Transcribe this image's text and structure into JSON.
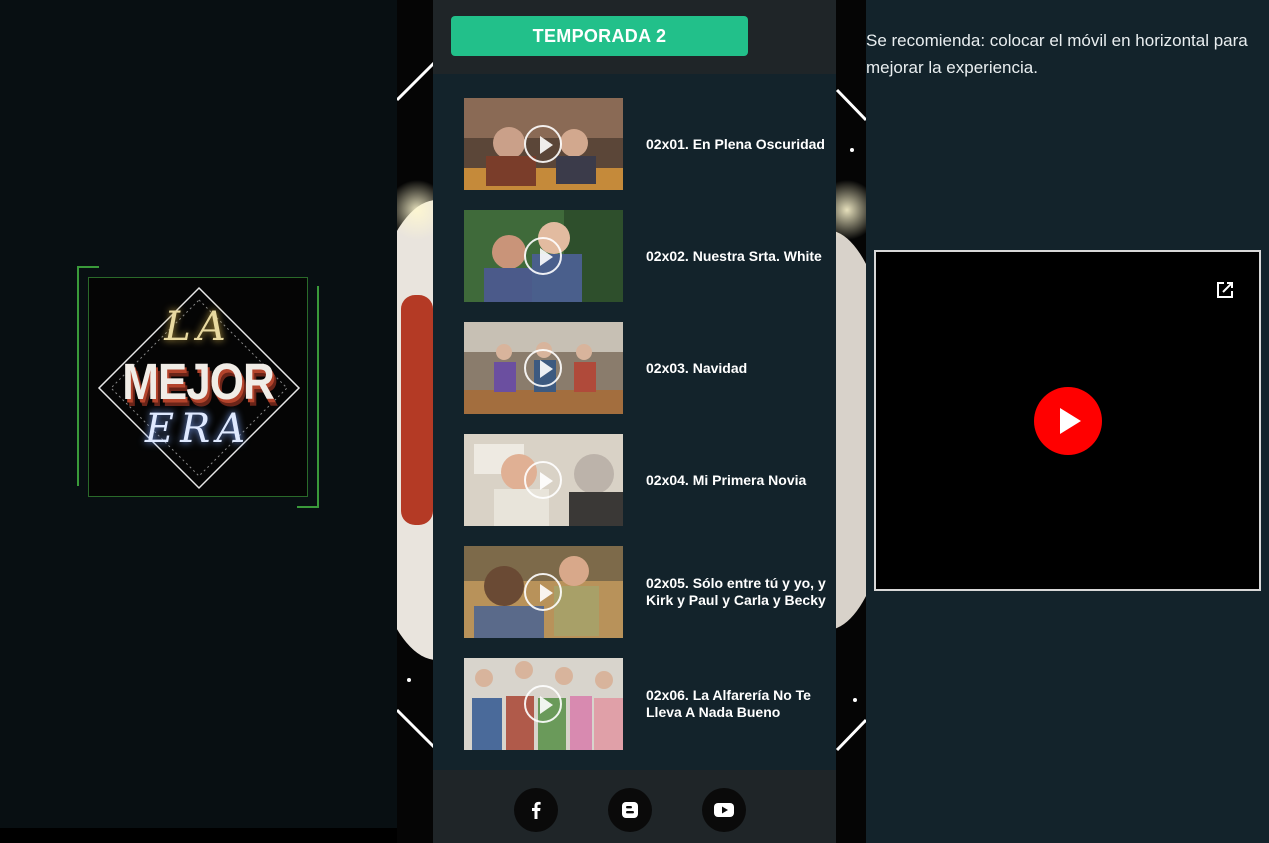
{
  "logo": {
    "line_top": "LA",
    "line_main": "MEJOR",
    "line_bottom": "ERA"
  },
  "season": {
    "label": "TEMPORADA 2"
  },
  "episodes": [
    {
      "title": "02x01. En Plena Oscuridad"
    },
    {
      "title": "02x02. Nuestra Srta. White"
    },
    {
      "title": "02x03. Navidad"
    },
    {
      "title": "02x04. Mi Primera Novia"
    },
    {
      "title": "02x05. Sólo entre tú y yo, y Kirk y Paul y Carla y Becky"
    },
    {
      "title": "02x06. La Alfarería No Te Lleva A Nada Bueno"
    }
  ],
  "footer": {
    "icons": [
      "facebook-icon",
      "blogger-icon",
      "youtube-icon"
    ]
  },
  "right": {
    "recommendation": "Se recomienda: colocar el móvil en horizontal para mejorar la experiencia."
  },
  "colors": {
    "accent": "#22c08a",
    "panel_bg": "#13232b",
    "header_bg": "#1f2528",
    "youtube_red": "#ff0000"
  }
}
